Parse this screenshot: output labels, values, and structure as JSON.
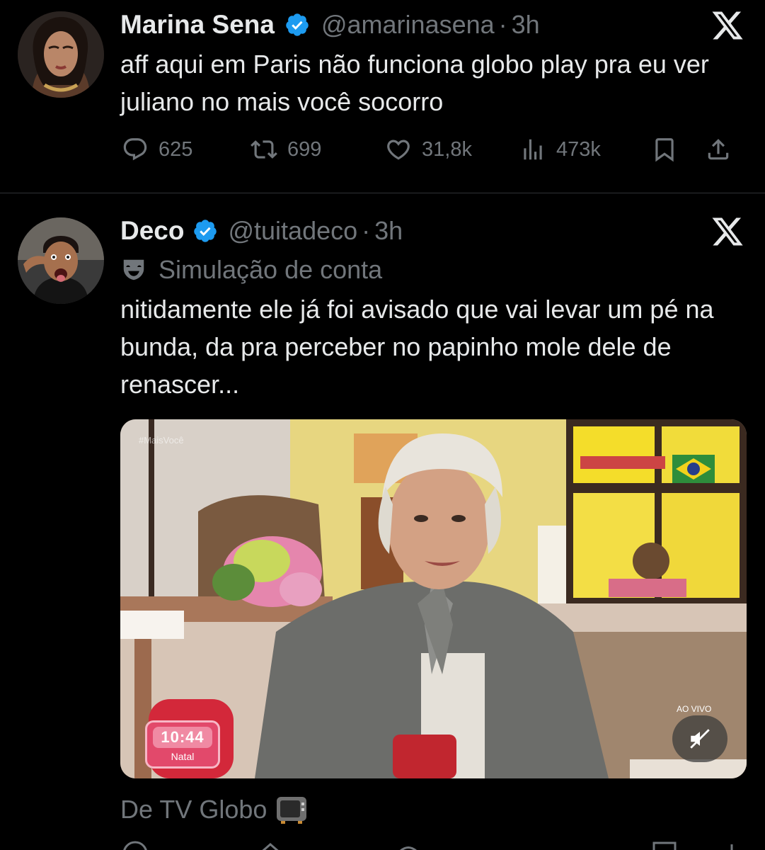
{
  "tweets": [
    {
      "name": "Marina Sena",
      "handle": "@amarinasena",
      "dot": "·",
      "time": "3h",
      "text": "aff aqui em Paris não funciona globo play pra eu ver juliano no mais você socorro",
      "replies": "625",
      "retweets": "699",
      "likes": "31,8k",
      "views": "473k"
    },
    {
      "name": "Deco",
      "handle": "@tuitadeco",
      "dot": "·",
      "time": "3h",
      "parody_label": "Simulação de conta",
      "text": "nitidamente ele já foi avisado que vai levar um pé na bunda, da pra perceber no papinho mole dele de renascer...",
      "media": {
        "watermark": "#MaisVocê",
        "clock": "10:44",
        "city": "Natal",
        "live": "AO VIVO"
      },
      "source": "De TV Globo"
    }
  ],
  "colors": {
    "background": "#000000",
    "text": "#e7e9ea",
    "muted": "#71767b",
    "verified": "#1d9bf0"
  }
}
